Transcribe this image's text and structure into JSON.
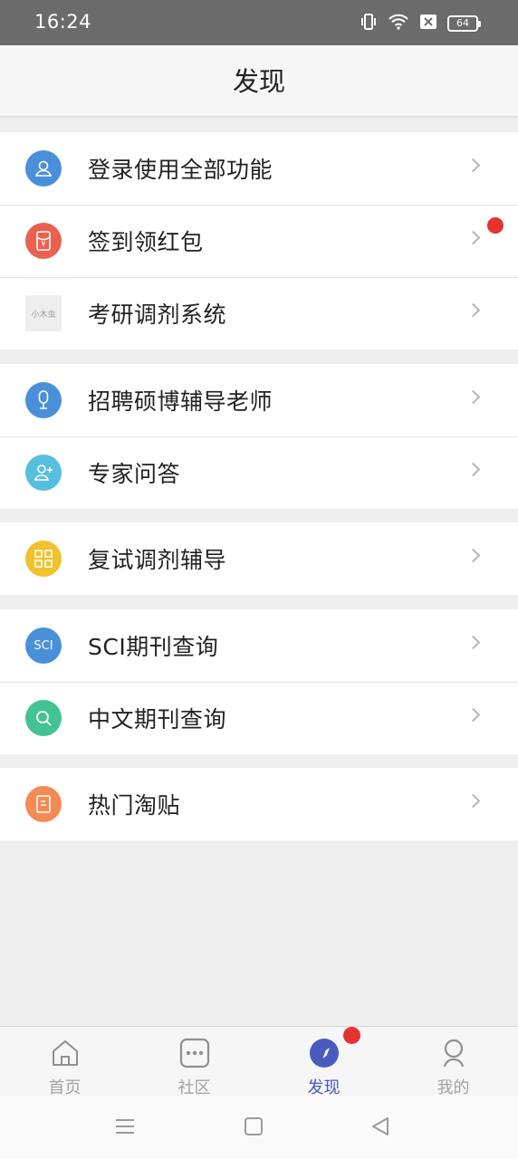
{
  "status_bar": {
    "time": "16:24",
    "battery": "64"
  },
  "header": {
    "title": "发现"
  },
  "groups": [
    {
      "items": [
        {
          "label": "登录使用全部功能",
          "icon": "user-icon",
          "color": "#4a90d9"
        },
        {
          "label": "签到领红包",
          "icon": "red-envelope-icon",
          "color": "#ea6150",
          "badge": true
        },
        {
          "label": "考研调剂系统",
          "icon": "logo-thumbnail",
          "color": "#eeeeee",
          "icon_text": "小木虫"
        }
      ]
    },
    {
      "items": [
        {
          "label": "招聘硕博辅导老师",
          "icon": "microphone-icon",
          "color": "#4a90d9"
        },
        {
          "label": "专家问答",
          "icon": "add-user-icon",
          "color": "#56bfe0"
        }
      ]
    },
    {
      "items": [
        {
          "label": "复试调剂辅导",
          "icon": "grid-icon",
          "color": "#f0c22b"
        }
      ]
    },
    {
      "items": [
        {
          "label": "SCI期刊查询",
          "icon": "sci-icon",
          "color": "#4a90d9",
          "icon_text": "SCI"
        },
        {
          "label": "中文期刊查询",
          "icon": "search-icon",
          "color": "#44c392"
        }
      ]
    },
    {
      "items": [
        {
          "label": "热门淘贴",
          "icon": "document-icon",
          "color": "#f48a54"
        }
      ]
    }
  ],
  "tabs": [
    {
      "label": "首页",
      "icon": "home-icon"
    },
    {
      "label": "社区",
      "icon": "chat-icon"
    },
    {
      "label": "发现",
      "icon": "compass-icon",
      "active": true,
      "badge": true
    },
    {
      "label": "我的",
      "icon": "profile-icon"
    }
  ]
}
